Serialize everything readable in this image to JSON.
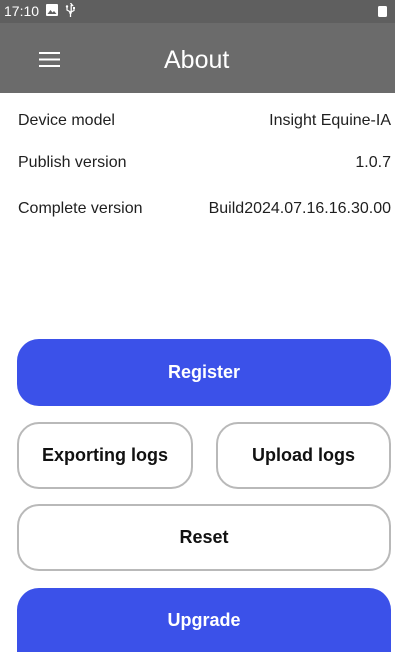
{
  "status_bar": {
    "time": "17:10",
    "icons": [
      "image-icon",
      "usb-icon",
      "battery-icon"
    ]
  },
  "app_bar": {
    "title": "About",
    "menu_icon": "hamburger-menu-icon"
  },
  "device_info": [
    {
      "label": "Device model",
      "value": "Insight Equine-IA"
    },
    {
      "label": "Publish version",
      "value": "1.0.7"
    },
    {
      "label": "Complete version",
      "value": "Build2024.07.16.16.30.00"
    }
  ],
  "buttons": {
    "register": "Register",
    "exporting_logs": "Exporting logs",
    "upload_logs": "Upload logs",
    "reset": "Reset",
    "upgrade": "Upgrade"
  },
  "colors": {
    "primary": "#3b51e9",
    "app_bar": "#6b6b6b",
    "status_bar": "#5f5f5f",
    "outline": "#b9b9b9"
  }
}
